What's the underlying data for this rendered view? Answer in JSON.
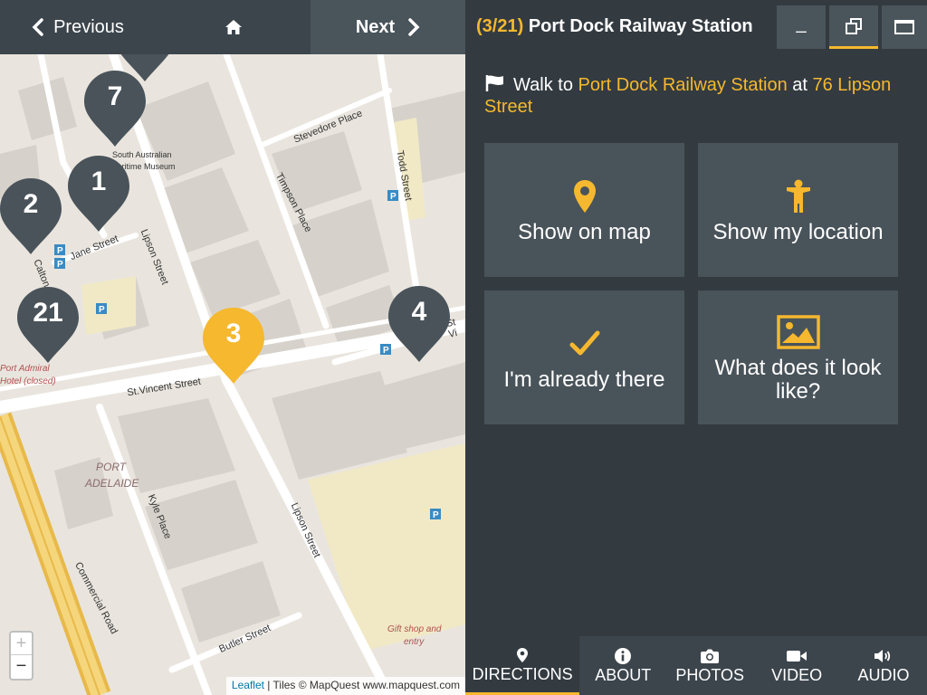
{
  "nav": {
    "prev_label": "Previous",
    "next_label": "Next"
  },
  "map": {
    "street_labels": [
      "Stevedore Place",
      "Todd Street",
      "Timpson Place",
      "Lipson Street",
      "Jane Street",
      "Calton",
      "St.Vincent Street",
      "Kyle Place",
      "Lipson Street",
      "Commercial Road",
      "Butler Street",
      "St Vi"
    ],
    "place_labels": [
      "South Australian",
      "Maritime Museum",
      "PORT",
      "ADELAIDE",
      "Port Admiral",
      "Hotel (closed)",
      "Gift shop and",
      "entry"
    ],
    "markers": [
      {
        "number": "7",
        "color": "#4a535a"
      },
      {
        "number": "1",
        "color": "#4a535a"
      },
      {
        "number": "2",
        "color": "#4a535a"
      },
      {
        "number": "21",
        "color": "#4a535a"
      },
      {
        "number": "3",
        "color": "#f5b82e"
      },
      {
        "number": "4",
        "color": "#4a535a"
      }
    ],
    "zoom_in": "+",
    "zoom_out": "−",
    "attribution_link": "Leaflet",
    "attribution_text": " | Tiles © MapQuest www.mapquest.com"
  },
  "panel": {
    "counter": "(3/21)",
    "title": "Port Dock Railway Station",
    "window_buttons": [
      "_",
      "restore",
      "maximize"
    ],
    "walk_prefix": "Walk to ",
    "walk_place": "Port Dock Railway Station",
    "walk_mid": " at ",
    "walk_address": "76 Lipson Street",
    "tiles": [
      {
        "label": "Show on map",
        "icon": "map-pin-icon"
      },
      {
        "label": "Show my location",
        "icon": "person-icon"
      },
      {
        "label": "I'm already there",
        "icon": "checkmark-icon"
      },
      {
        "label": "What does it look like?",
        "icon": "image-icon"
      }
    ],
    "tabs": [
      {
        "label": "DIRECTIONS",
        "icon": "map-pin-icon",
        "active": true
      },
      {
        "label": "ABOUT",
        "icon": "info-icon",
        "active": false
      },
      {
        "label": "PHOTOS",
        "icon": "camera-icon",
        "active": false
      },
      {
        "label": "VIDEO",
        "icon": "video-camera-icon",
        "active": false
      },
      {
        "label": "AUDIO",
        "icon": "speaker-icon",
        "active": false
      }
    ]
  },
  "colors": {
    "accent": "#f5b82e",
    "panel_bg": "#333b41",
    "tile_bg": "#49535a",
    "marker_dark": "#4a535a"
  }
}
